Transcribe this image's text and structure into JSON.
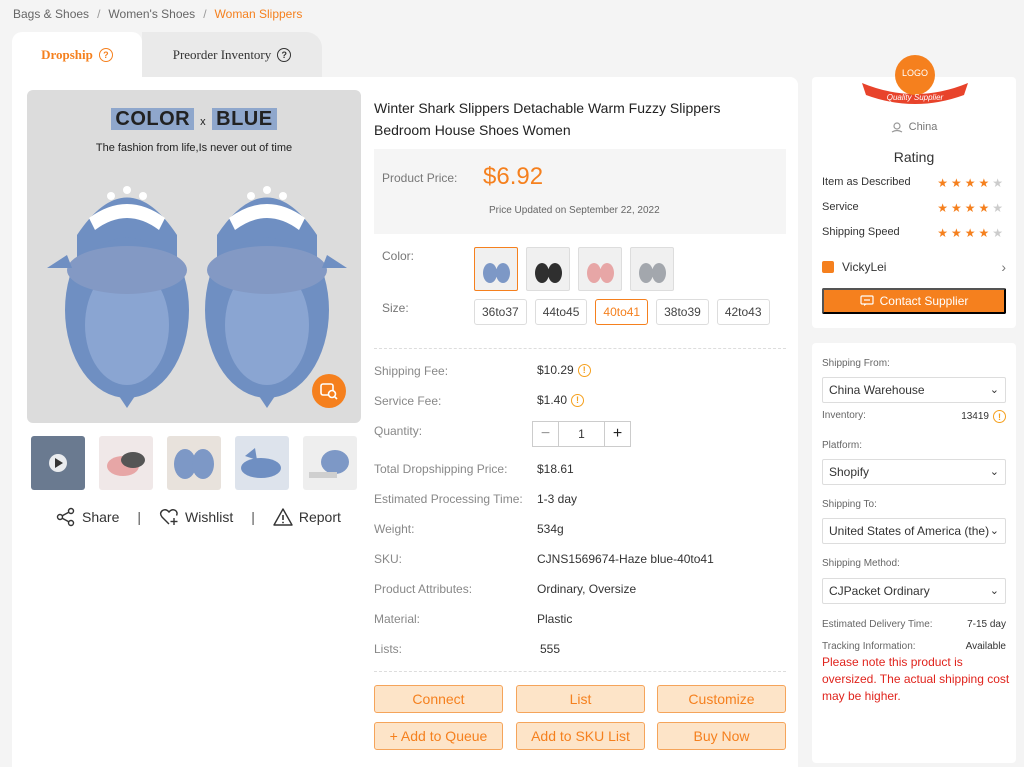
{
  "breadcrumb": {
    "items": [
      "Bags & Shoes",
      "Women's Shoes",
      "Woman Slippers"
    ],
    "separator": "/"
  },
  "tabs": [
    {
      "label": "Dropship",
      "active": true
    },
    {
      "label": "Preorder Inventory",
      "active": false
    }
  ],
  "image": {
    "title_left": "COLOR",
    "title_x": "x",
    "title_right": "BLUE",
    "subtitle": "The fashion from life,Is never out of time"
  },
  "actions": {
    "share": "Share",
    "wishlist": "Wishlist",
    "report": "Report",
    "separator": "|"
  },
  "product": {
    "title": "Winter Shark Slippers Detachable Warm Fuzzy Slippers Bedroom House Shoes Women",
    "price_label": "Product Price:",
    "price": "$6.92",
    "price_updated": "Price Updated on September 22, 2022",
    "color_label": "Color:",
    "size_label": "Size:",
    "sizes": [
      "36to37",
      "44to45",
      "40to41",
      "38to39",
      "42to43"
    ],
    "selected_size": "40to41"
  },
  "details": {
    "shipping_fee_label": "Shipping Fee:",
    "shipping_fee": "$10.29",
    "service_fee_label": "Service Fee:",
    "service_fee": "$1.40",
    "quantity_label": "Quantity:",
    "quantity": "1",
    "total_label": "Total Dropshipping Price:",
    "total": "$18.61",
    "processing_label": "Estimated Processing Time:",
    "processing": "1-3 day",
    "weight_label": "Weight:",
    "weight": "534g",
    "sku_label": "SKU:",
    "sku": "CJNS1569674-Haze blue-40to41",
    "attributes_label": "Product Attributes:",
    "attributes": "Ordinary, Oversize",
    "material_label": "Material:",
    "material": "Plastic",
    "lists_label": "Lists:",
    "lists": "555"
  },
  "buttons": {
    "connect": "Connect",
    "list": "List",
    "customize": "Customize",
    "add_queue": "+ Add to Queue",
    "add_sku": "Add to SKU List",
    "buy_now": "Buy Now"
  },
  "supplier": {
    "logo_text": "LOGO",
    "badge_text": "Quality Supplier",
    "country": "China",
    "rating_title": "Rating",
    "ratings": [
      {
        "label": "Item as Described",
        "stars": 4
      },
      {
        "label": "Service",
        "stars": 4
      },
      {
        "label": "Shipping Speed",
        "stars": 4
      }
    ],
    "name": "VickyLei",
    "contact": "Contact Supplier"
  },
  "shipping": {
    "from_label": "Shipping From:",
    "from": "China Warehouse",
    "inventory_label": "Inventory:",
    "inventory": "13419",
    "platform_label": "Platform:",
    "platform": "Shopify",
    "to_label": "Shipping To:",
    "to": "United States of America (the)",
    "method_label": "Shipping Method:",
    "method": "CJPacket Ordinary",
    "delivery_label": "Estimated Delivery Time:",
    "delivery": "7-15 day",
    "tracking_label": "Tracking Information:",
    "tracking": "Available",
    "note": "Please note this product is oversized. The actual shipping cost may be higher."
  },
  "colors": {
    "accent": "#f5801e",
    "button_bg": "#fde4c8",
    "warning_text": "#e0241d"
  },
  "icons": {
    "help": "question-circle-icon",
    "share": "share-icon",
    "wishlist": "heart-plus-icon",
    "report": "warning-triangle-icon",
    "info": "exclamation-circle-icon"
  }
}
